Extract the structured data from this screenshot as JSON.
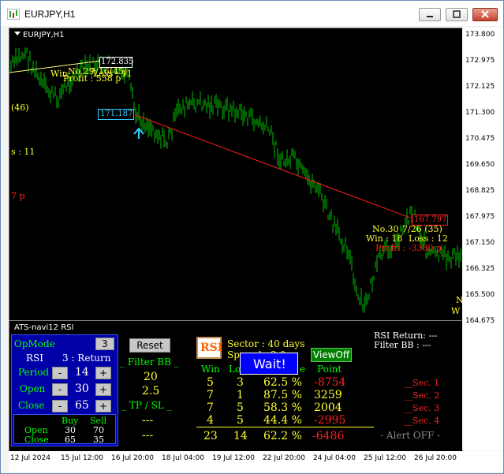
{
  "window": {
    "title": "EURJPY,H1"
  },
  "chart": {
    "symbol_label": "EURJPY,H1",
    "y_ticks": [
      "173.800",
      "172.975",
      "172.125",
      "171.300",
      "170.475",
      "169.650",
      "168.825",
      "167.975",
      "167.150",
      "166.325",
      "165.500",
      "164.675"
    ],
    "x_ticks": [
      "12 Jul 2024",
      "15 Jul 12:00",
      "16 Jul 20:00",
      "18 Jul 04:00",
      "19 Jul 12:00",
      "22 Jul 20:00",
      "24 Jul 04:00",
      "25 Jul 12:00",
      "26 Jul 20:00"
    ],
    "overlay": {
      "price_top_box": "172.835",
      "price_mid_box": "171.187",
      "price_end_box": "167.797",
      "left_no": "No.29",
      "left_date": "7/16(45)",
      "left_win": "Win",
      "left_loss": "Loss : 11",
      "left_profit": "Profit : 558 p",
      "left_46": "(46)",
      "left_s": "s : 11",
      "left_7p": "7 p",
      "right_no": "No.30",
      "right_date": "7/26 (35)",
      "right_win": "Win : 18",
      "right_loss": "Loss : 12",
      "right_profit": "Profit : -3380 p",
      "edge_n": "N",
      "edge_w": "W",
      "arrow": "↑"
    }
  },
  "panel": {
    "title": "ATS-navi12  RSI",
    "opmode_label": "OpMode",
    "opmode_value": "3",
    "rsi_label": "RSI",
    "rsi_mode": "3 : Return",
    "period_label": "Period",
    "period_value": "14",
    "open_label": "Open",
    "open_value": "30",
    "close_label": "Close",
    "close_value": "65",
    "minus": "-",
    "plus": "+",
    "buy_header": "Buy",
    "sell_header": "Sell",
    "open_row_label": "Open",
    "close_row_label": "Close",
    "open_buy": "30",
    "open_sell": "70",
    "close_buy": "65",
    "close_sell": "35",
    "reset_label": "Reset",
    "filter_bb_label": "_ Filter BB _",
    "filter_val1": "20",
    "filter_val2": "2.5",
    "tp_sl_label": "_ TP  /  SL _",
    "tp_val": "---",
    "sl_val": "---",
    "rsi_logo": "RSI",
    "sector": "Sector : 40 days",
    "spread": "Spread : 2.0",
    "wait": "Wait!",
    "viewoff": "ViewOff",
    "rsi_return": "RSI Return: ---",
    "filter_bb_status": "Filter BB  : ---",
    "headers": {
      "win": "Win",
      "loss": "Lo",
      "rate": "e",
      "point": "Point"
    },
    "rows": [
      {
        "win": "5",
        "loss": "3",
        "rate": "62.5 %",
        "point": "-8754",
        "neg": true,
        "sec": "__Sec. 1"
      },
      {
        "win": "7",
        "loss": "1",
        "rate": "87.5 %",
        "point": "3259",
        "neg": false,
        "sec": "__Sec. 2"
      },
      {
        "win": "7",
        "loss": "5",
        "rate": "58.3 %",
        "point": "2004",
        "neg": false,
        "sec": "__Sec. 3"
      },
      {
        "win": "4",
        "loss": "5",
        "rate": "44.4 %",
        "point": "-2995",
        "neg": true,
        "sec": "__Sec. 4"
      }
    ],
    "total": {
      "win": "23",
      "loss": "14",
      "rate": "62.2 %",
      "point": "-6486"
    },
    "alert": "- Alert OFF -"
  },
  "colors": {
    "bull": "#00c000",
    "yellow": "#ffff30",
    "red": "#ff2020",
    "cyan": "#33ccff",
    "panel_blue": "#0000a8"
  }
}
